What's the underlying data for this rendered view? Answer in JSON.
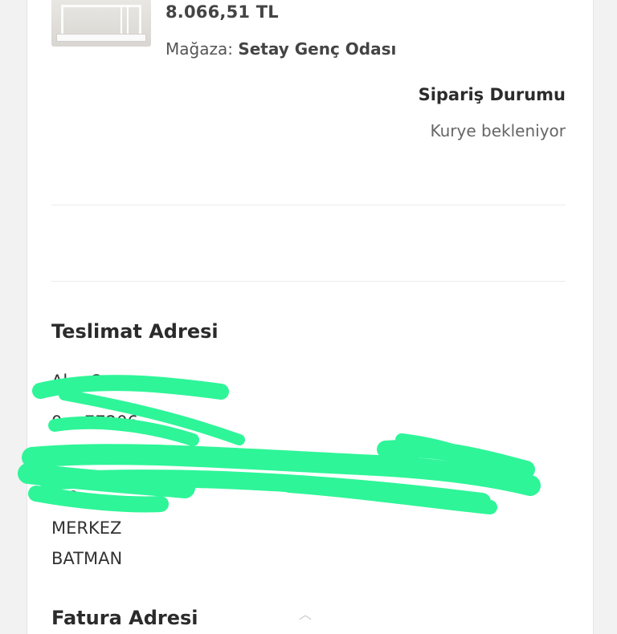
{
  "order_item": {
    "price": "8.066,51 TL",
    "store_label": "Mağaza:",
    "store_name": "Setay Genç Odası",
    "image_alt": "bunk-bed-photo"
  },
  "order_status": {
    "title": "Sipariş Durumu",
    "value": "Kurye bekleniyor"
  },
  "delivery_address": {
    "title": "Teslimat Adresi",
    "name_redacted": "Al… Onar",
    "phone_redacted": "0… 77206",
    "street_redacted": "…",
    "line4_redacted": "…2",
    "district": "MERKEZ",
    "city": "BATMAN"
  },
  "next_section": {
    "title": "Fatura Adresi"
  },
  "colors": {
    "redaction": "#2ef598",
    "background": "#f2f2f2",
    "card": "#ffffff"
  }
}
